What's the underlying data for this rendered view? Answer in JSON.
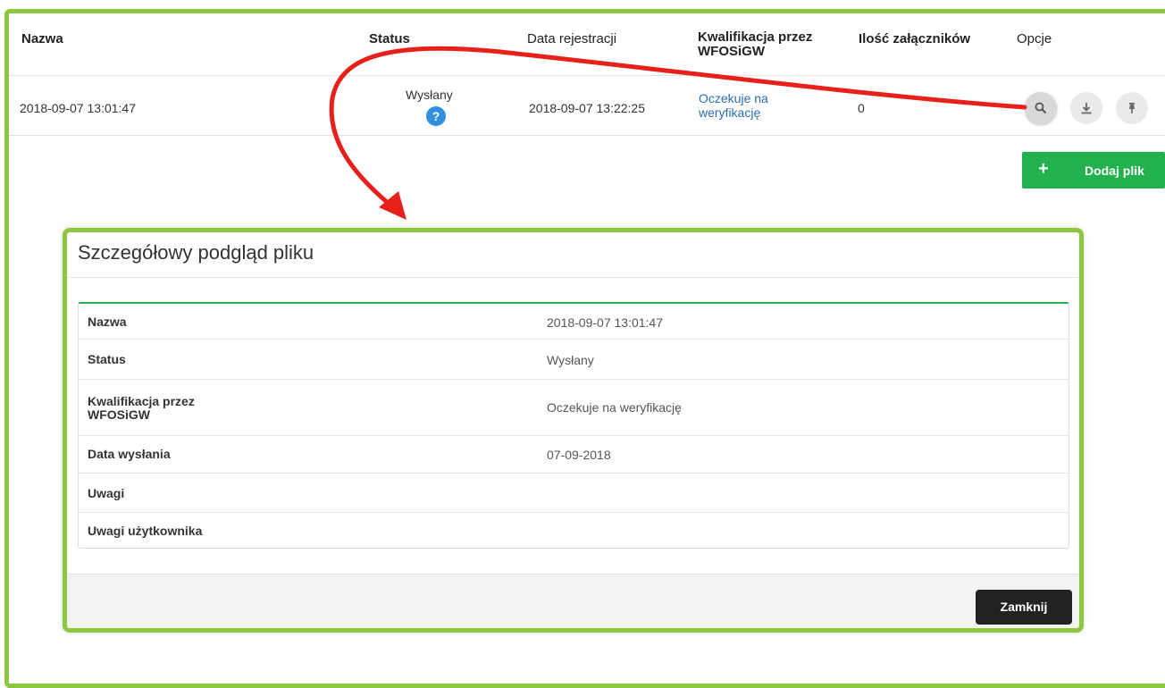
{
  "table": {
    "headers": {
      "name": "Nazwa",
      "status": "Status",
      "reg_date": "Data rejestracji",
      "qualification_line1": "Kwalifikacja przez",
      "qualification_line2": "WFOSiGW",
      "attachments": "Ilość załączników",
      "options": "Opcje"
    },
    "row": {
      "name": "2018-09-07 13:01:47",
      "status": "Wysłany",
      "help_icon": "?",
      "reg_date": "2018-09-07 13:22:25",
      "qualification_line1": "Oczekuje na",
      "qualification_line2": "weryfikację",
      "attachments": "0"
    },
    "option_icons": [
      "search-icon",
      "download-icon",
      "pin-icon"
    ]
  },
  "add_button": {
    "icon": "+",
    "label": "Dodaj plik"
  },
  "modal": {
    "title": "Szczegółowy podgląd pliku",
    "rows": [
      {
        "label": "Nazwa",
        "value": "2018-09-07 13:01:47"
      },
      {
        "label": "Status",
        "value": "Wysłany"
      },
      {
        "label_line1": "Kwalifikacja przez",
        "label_line2": "WFOSiGW",
        "value": "Oczekuje na weryfikację"
      },
      {
        "label": "Data wysłania",
        "value": "07-09-2018"
      },
      {
        "label": "Uwagi",
        "value": ""
      },
      {
        "label": "Uwagi użytkownika",
        "value": ""
      }
    ],
    "close_label": "Zamknij"
  },
  "colors": {
    "highlight_border": "#8dc63f",
    "accent_green": "#22b14c",
    "link_blue": "#2a6fb0",
    "annotation_arrow": "#e8201a",
    "close_button": "#222222"
  }
}
